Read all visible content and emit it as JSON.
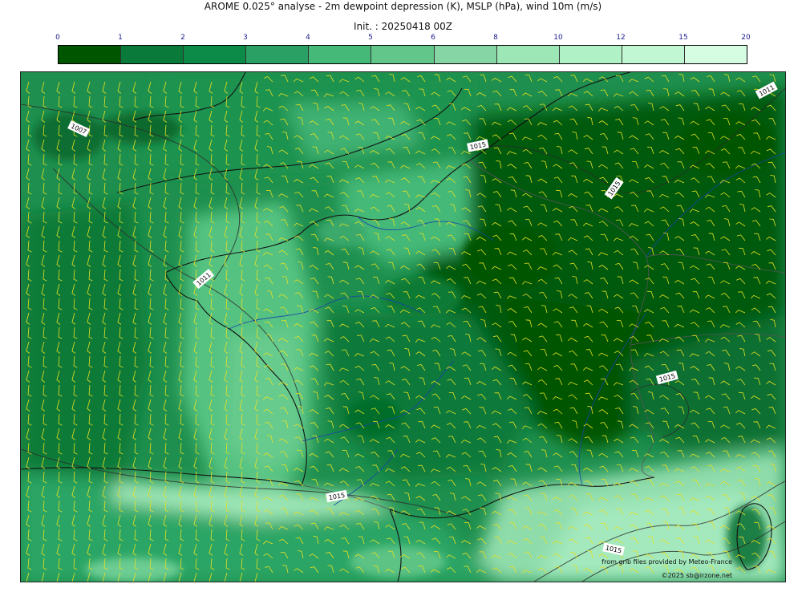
{
  "header": {
    "title": "AROME 0.025° analyse - 2m dewpoint depression (K), MSLP (hPa), wind 10m (m/s)",
    "init": "Init. : 20250418 00Z"
  },
  "colorbar": {
    "ticks": [
      "0",
      "1",
      "2",
      "3",
      "4",
      "5",
      "6",
      "8",
      "10",
      "12",
      "15",
      "20"
    ],
    "colors": [
      "#005500",
      "#0a7a3a",
      "#0b8a48",
      "#2aa064",
      "#45b978",
      "#62c68a",
      "#85d6a4",
      "#9de6b6",
      "#b0f1c6",
      "#c2f7d3",
      "#d6fde2"
    ]
  },
  "isobars": {
    "labels": [
      "1007",
      "1011",
      "1011",
      "1015",
      "1015",
      "1015",
      "1015",
      "1015"
    ]
  },
  "credits": {
    "source": "from grib files provided by Meteo-France",
    "copyright": "©2025 sb@irzone.net"
  }
}
